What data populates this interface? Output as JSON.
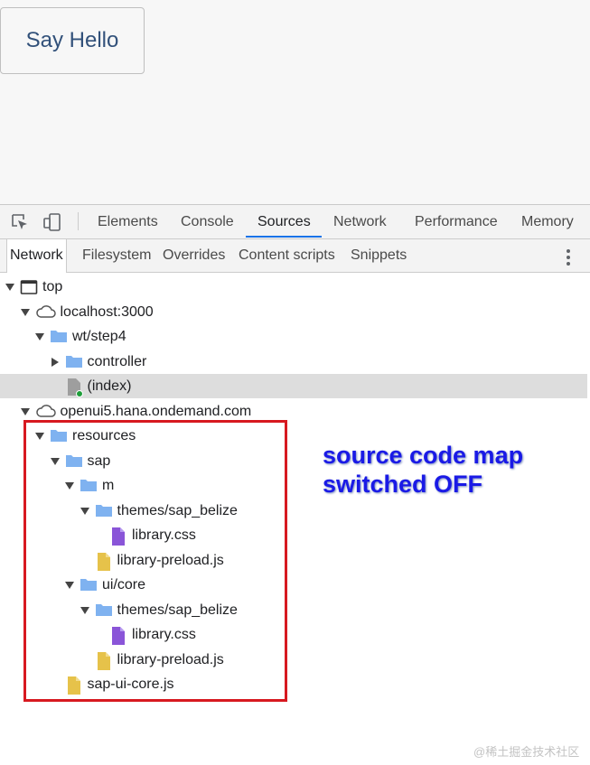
{
  "app": {
    "button_label": "Say Hello"
  },
  "devtools": {
    "main_tabs": [
      "Elements",
      "Console",
      "Sources",
      "Network",
      "Performance",
      "Memory"
    ],
    "active_main_tab": "Sources",
    "sub_tabs": [
      "Network",
      "Filesystem",
      "Overrides",
      "Content scripts",
      "Snippets"
    ],
    "active_sub_tab": "Network",
    "tree": [
      {
        "label": "top",
        "icon": "frame-icon",
        "expanded": true
      },
      {
        "label": "localhost:3000",
        "icon": "cloud-icon",
        "expanded": true
      },
      {
        "label": "wt/step4",
        "icon": "folder-icon",
        "expanded": true
      },
      {
        "label": "controller",
        "icon": "folder-icon",
        "expanded": false
      },
      {
        "label": "(index)",
        "icon": "document-icon",
        "selected": true
      },
      {
        "label": "openui5.hana.ondemand.com",
        "icon": "cloud-icon",
        "expanded": true
      },
      {
        "label": "resources",
        "icon": "folder-icon",
        "expanded": true
      },
      {
        "label": "sap",
        "icon": "folder-icon",
        "expanded": true
      },
      {
        "label": "m",
        "icon": "folder-icon",
        "expanded": true
      },
      {
        "label": "themes/sap_belize",
        "icon": "folder-icon",
        "expanded": true
      },
      {
        "label": "library.css",
        "icon": "css-file-icon"
      },
      {
        "label": "library-preload.js",
        "icon": "js-file-icon"
      },
      {
        "label": "ui/core",
        "icon": "folder-icon",
        "expanded": true
      },
      {
        "label": "themes/sap_belize",
        "icon": "folder-icon",
        "expanded": true
      },
      {
        "label": "library.css",
        "icon": "css-file-icon"
      },
      {
        "label": "library-preload.js",
        "icon": "js-file-icon"
      },
      {
        "label": "sap-ui-core.js",
        "icon": "js-file-icon"
      }
    ]
  },
  "annotation": {
    "text": "source code map\nswitched OFF"
  },
  "watermark": "@稀土掘金技术社区",
  "colors": {
    "accent": "#1a73e8",
    "highlight_box": "#d71920",
    "annotation_text": "#1a1ae6",
    "folder": "#7fb2f0",
    "css_file": "#8a55d8",
    "js_file": "#e6c24a"
  }
}
